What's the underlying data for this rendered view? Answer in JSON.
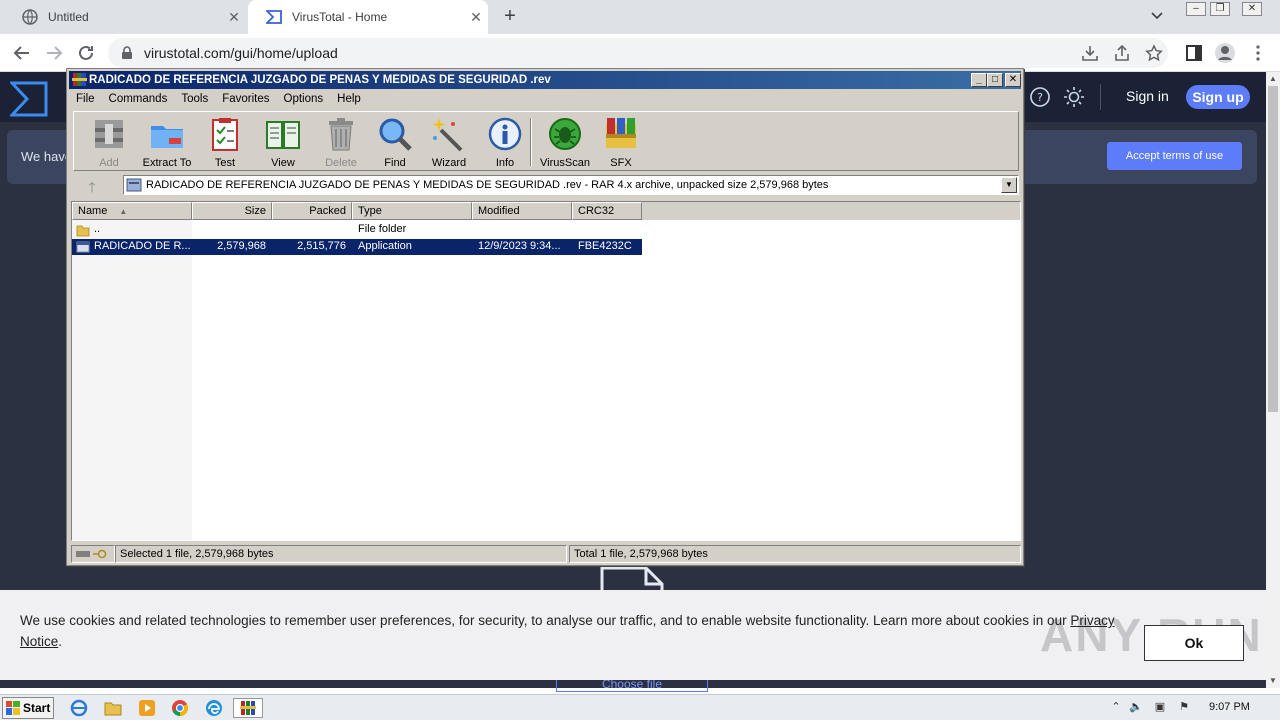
{
  "browser": {
    "tabs": [
      {
        "title": "Untitled"
      },
      {
        "title": "VirusTotal - Home"
      }
    ],
    "url": "virustotal.com/gui/home/upload"
  },
  "virustotal": {
    "signin": "Sign in",
    "signup": "Sign up",
    "banner_text": "We have",
    "accept_button": "Accept terms of use",
    "choose_file": "Choose file",
    "brand_color": "#5c7cfa"
  },
  "cookie": {
    "text": "We use cookies and related technologies to remember user preferences, for security, to analyse our traffic, and to enable website functionality. Learn more about cookies in our ",
    "link": "Privacy Notice",
    "ok": "Ok",
    "watermark": "ANY RUN"
  },
  "winrar": {
    "title": "RADICADO DE REFERENCIA JUZGADO DE PENAS Y MEDIDAS DE SEGURIDAD .rev",
    "menu": [
      "File",
      "Commands",
      "Tools",
      "Favorites",
      "Options",
      "Help"
    ],
    "tools": [
      {
        "label": "Add",
        "icon": "add-icon"
      },
      {
        "label": "Extract To",
        "icon": "extract-icon"
      },
      {
        "label": "Test",
        "icon": "test-icon"
      },
      {
        "label": "View",
        "icon": "view-icon"
      },
      {
        "label": "Delete",
        "icon": "delete-icon"
      },
      {
        "label": "Find",
        "icon": "find-icon"
      },
      {
        "label": "Wizard",
        "icon": "wizard-icon"
      },
      {
        "label": "Info",
        "icon": "info-icon"
      },
      {
        "label": "VirusScan",
        "icon": "virusscan-icon"
      },
      {
        "label": "SFX",
        "icon": "sfx-icon"
      }
    ],
    "path": "RADICADO DE REFERENCIA JUZGADO DE PENAS Y MEDIDAS DE SEGURIDAD .rev - RAR 4.x archive, unpacked size 2,579,968 bytes",
    "columns": [
      "Name",
      "Size",
      "Packed",
      "Type",
      "Modified",
      "CRC32"
    ],
    "rows": [
      {
        "name": "..",
        "size": "",
        "packed": "",
        "type": "File folder",
        "modified": "",
        "crc": ""
      },
      {
        "name": "RADICADO DE R...",
        "size": "2,579,968",
        "packed": "2,515,776",
        "type": "Application",
        "modified": "12/9/2023 9:34...",
        "crc": "FBE4232C"
      }
    ],
    "status_left": "Selected 1 file, 2,579,968 bytes",
    "status_right": "Total 1 file, 2,579,968 bytes"
  },
  "taskbar": {
    "start": "Start",
    "clock": "9:07 PM"
  }
}
